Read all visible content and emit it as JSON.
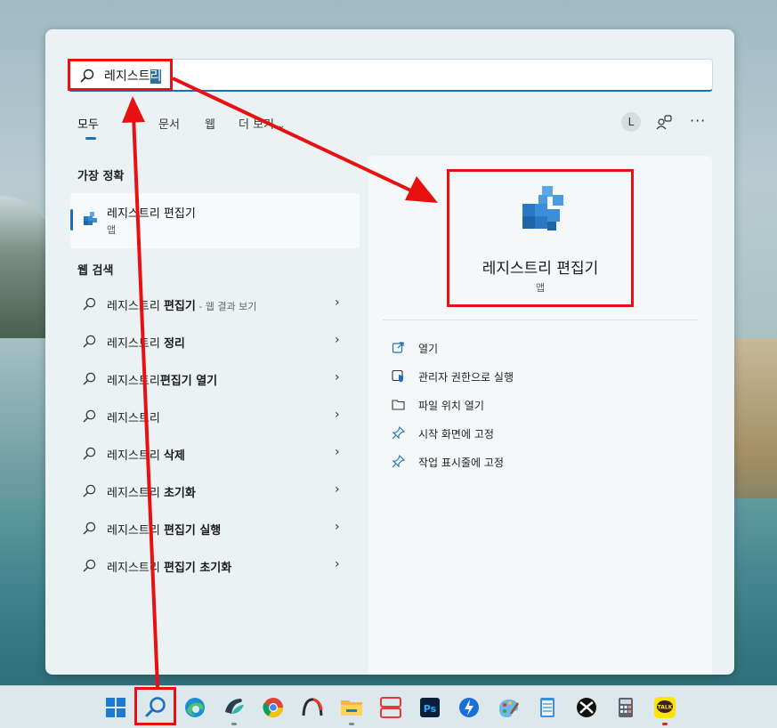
{
  "search": {
    "query_prefix": "레지스트",
    "query_selected": "리"
  },
  "tabs": [
    {
      "label": "모두"
    },
    {
      "label": "문서"
    },
    {
      "label": "웹"
    },
    {
      "label": "더 보기"
    }
  ],
  "header": {
    "avatar_letter": "L",
    "more_label": "···"
  },
  "best_match": {
    "title": "가장 정확",
    "app_name": "레지스트리 편집기",
    "app_type": "앱"
  },
  "web_search": {
    "title": "웹 검색",
    "items": [
      {
        "prefix": "레지스트리 ",
        "bold": "편집기",
        "suffix": " - 웹 결과 보기"
      },
      {
        "prefix": "레지스트리 ",
        "bold": "정리",
        "suffix": ""
      },
      {
        "prefix": "레지스트리",
        "bold": "편집기 열기",
        "suffix": ""
      },
      {
        "prefix": "레지스트리",
        "bold": "",
        "suffix": ""
      },
      {
        "prefix": "레지스트리 ",
        "bold": "삭제",
        "suffix": ""
      },
      {
        "prefix": "레지스트리 ",
        "bold": "초기화",
        "suffix": ""
      },
      {
        "prefix": "레지스트리 ",
        "bold": "편집기 실행",
        "suffix": ""
      },
      {
        "prefix": "레지스트리 ",
        "bold": "편집기 초기화",
        "suffix": ""
      }
    ]
  },
  "detail": {
    "app_name": "레지스트리 편집기",
    "app_type": "앱",
    "actions": [
      {
        "label": "열기",
        "icon": "open-icon"
      },
      {
        "label": "관리자 권한으로 실행",
        "icon": "shield-icon"
      },
      {
        "label": "파일 위치 열기",
        "icon": "folder-icon"
      },
      {
        "label": "시작 화면에 고정",
        "icon": "pin-icon"
      },
      {
        "label": "작업 표시줄에 고정",
        "icon": "pin-icon"
      }
    ]
  },
  "taskbar": {
    "items": [
      {
        "name": "start",
        "icon": "windows-icon"
      },
      {
        "name": "search",
        "icon": "search-icon"
      },
      {
        "name": "edge",
        "icon": "edge-icon"
      },
      {
        "name": "app-bird",
        "icon": "bird-icon"
      },
      {
        "name": "chrome",
        "icon": "chrome-icon"
      },
      {
        "name": "app-arc",
        "icon": "arc-icon"
      },
      {
        "name": "file-explorer",
        "icon": "folder-icon"
      },
      {
        "name": "app-windows",
        "icon": "split-window-icon"
      },
      {
        "name": "photoshop",
        "icon": "photoshop-icon",
        "label": "Ps"
      },
      {
        "name": "app-bolt",
        "icon": "bolt-icon"
      },
      {
        "name": "paint",
        "icon": "paint-icon"
      },
      {
        "name": "notepad",
        "icon": "notepad-icon"
      },
      {
        "name": "xbox",
        "icon": "xbox-icon"
      },
      {
        "name": "calculator",
        "icon": "calculator-icon"
      },
      {
        "name": "kakaotalk",
        "icon": "kakaotalk-icon",
        "label": "TALK"
      }
    ]
  },
  "colors": {
    "accent": "#1f6fb6",
    "annotation": "#e81010"
  }
}
